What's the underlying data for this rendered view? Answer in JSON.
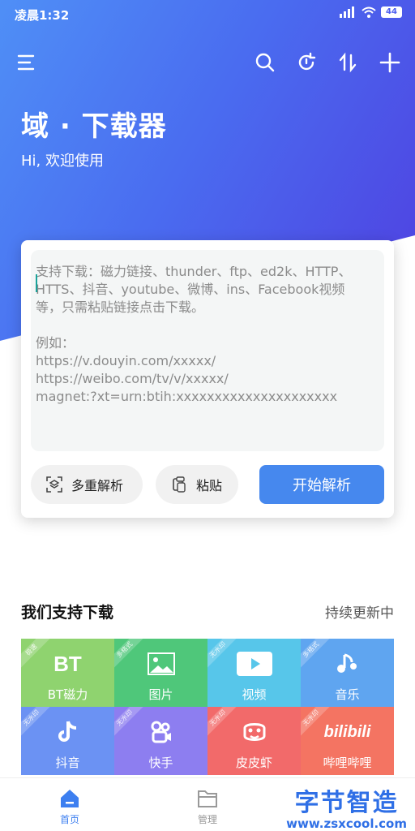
{
  "status_bar": {
    "time": "凌晨1:32",
    "battery": "44"
  },
  "colors": {
    "accent": "#4688ee",
    "hero_start": "#4f8ff6",
    "hero_end": "#4f3fe0"
  },
  "toolbar": {
    "icons": [
      "menu-icon",
      "search-icon",
      "refresh-icon",
      "sort-icon",
      "add-icon"
    ]
  },
  "header": {
    "title": "域 · 下载器",
    "subtitle": "Hi, 欢迎使用"
  },
  "input": {
    "placeholder_lines": [
      "支持下载：磁力链接、thunder、ftp、ed2k、HTTP、",
      "HTTS、抖音、youtube、微博、ins、Facebook视频",
      "等，只需粘贴链接点击下载。",
      "",
      "例如：",
      "https://v.douyin.com/xxxxx/",
      "https://weibo.com/tv/v/xxxxx/",
      "magnet:?xt=urn:btih:xxxxxxxxxxxxxxxxxxxxx"
    ]
  },
  "actions": {
    "multi_parse": "多重解析",
    "paste": "粘贴",
    "start": "开始解析"
  },
  "section": {
    "title": "我们支持下载",
    "note": "持续更新中"
  },
  "tiles": [
    {
      "label": "BT磁力",
      "badge": "极速",
      "icon": "bt-icon",
      "color": "#8fd36f",
      "glyph": "BT"
    },
    {
      "label": "图片",
      "badge": "多格式",
      "icon": "image-icon",
      "color": "#4fc77a"
    },
    {
      "label": "视频",
      "badge": "无水印",
      "icon": "video-icon",
      "color": "#57c6ea"
    },
    {
      "label": "音乐",
      "badge": "多格式",
      "icon": "music-icon",
      "color": "#5fa5f0"
    },
    {
      "label": "抖音",
      "badge": "无水印",
      "icon": "tiktok-icon",
      "color": "#6b92f3"
    },
    {
      "label": "快手",
      "badge": "无水印",
      "icon": "kuaishou-icon",
      "color": "#8d7ef0"
    },
    {
      "label": "皮皮虾",
      "badge": "无水印",
      "icon": "pipixia-icon",
      "color": "#f26a6a"
    },
    {
      "label": "哔哩哔哩",
      "badge": "无水印",
      "icon": "bilibili-icon",
      "color": "#f47462",
      "glyph": "bilibili"
    }
  ],
  "tabbar": {
    "home": "首页",
    "manage": "管理"
  },
  "watermark": {
    "main": "字节智造",
    "url": "www.zsxcool.com"
  }
}
